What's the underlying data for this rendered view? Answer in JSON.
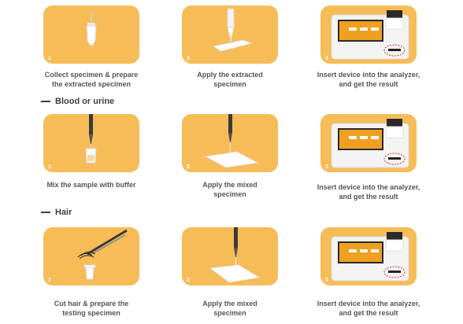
{
  "rows": [
    {
      "cards": [
        {
          "number": "1",
          "caption_lines": [
            "Collect specimen & prepare",
            "the extracted specimen"
          ],
          "icon": "swab-tube-icon"
        },
        {
          "number": "2",
          "caption_lines": [
            "Apply the extracted",
            "specimen"
          ],
          "icon": "dropper-strip-icon"
        },
        {
          "number": "3",
          "caption_lines": [
            "Insert device into the analyzer,",
            "and get the result"
          ],
          "icon": "analyzer-icon"
        }
      ]
    },
    {
      "section_title": "Blood or urine",
      "cards": [
        {
          "number": "1",
          "caption_lines": [
            "Mix the sample with buffer"
          ],
          "icon": "pipette-tube-icon"
        },
        {
          "number": "2",
          "caption_lines": [
            "Apply the mixed",
            "specimen"
          ],
          "icon": "pipette-strip-icon"
        },
        {
          "number": "3",
          "caption_lines": [
            "Insert device into the analyzer,",
            "and get the result"
          ],
          "icon": "analyzer-icon"
        }
      ]
    },
    {
      "section_title": "Hair",
      "cards": [
        {
          "number": "1",
          "caption_lines": [
            "Cut hair & prepare the",
            "testing specimen"
          ],
          "icon": "scissors-hair-icon"
        },
        {
          "number": "2",
          "caption_lines": [
            "Apply the mixed",
            "specimen"
          ],
          "icon": "pipette-strip-icon"
        },
        {
          "number": "3",
          "caption_lines": [
            "Insert device into the analyzer,",
            "and get the result"
          ],
          "icon": "analyzer-icon"
        }
      ]
    }
  ],
  "colors": {
    "card_bg": "#f6bc57",
    "device_screen": "#f0a020",
    "dashed_circle": "#e03030"
  }
}
